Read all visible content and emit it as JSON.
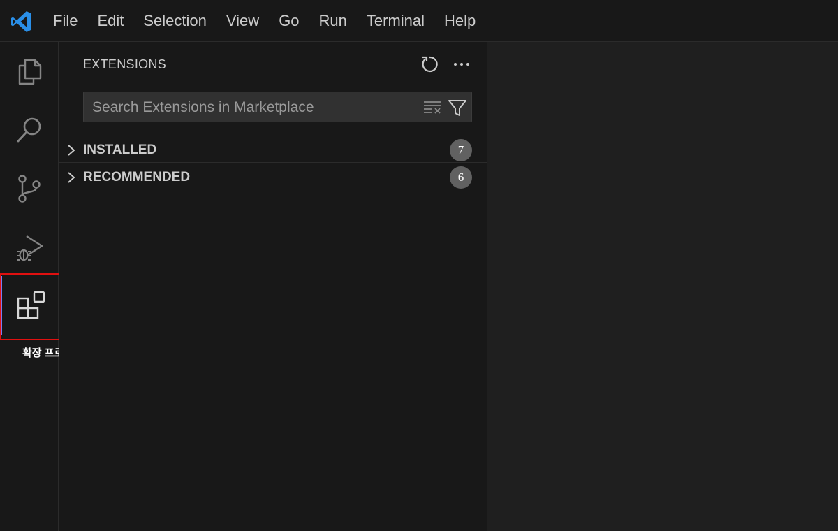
{
  "menu": {
    "items": [
      "File",
      "Edit",
      "Selection",
      "View",
      "Go",
      "Run",
      "Terminal",
      "Help"
    ]
  },
  "activity_bar": {
    "items": [
      {
        "icon": "explorer-icon"
      },
      {
        "icon": "search-icon"
      },
      {
        "icon": "source-control-icon"
      },
      {
        "icon": "run-debug-icon"
      },
      {
        "icon": "extensions-icon",
        "active": true
      }
    ],
    "tooltip": "확장 프로그램은 여기서 설치 할 수 있어요"
  },
  "sidebar": {
    "title": "EXTENSIONS",
    "search": {
      "placeholder": "Search Extensions in Marketplace",
      "value": ""
    },
    "sections": [
      {
        "label": "INSTALLED",
        "count": "7"
      },
      {
        "label": "RECOMMENDED",
        "count": "6"
      }
    ]
  },
  "colors": {
    "accent": "#7c7cf0",
    "highlight": "#e01010",
    "logo": "#2a8fe8",
    "badge": "#616161"
  }
}
